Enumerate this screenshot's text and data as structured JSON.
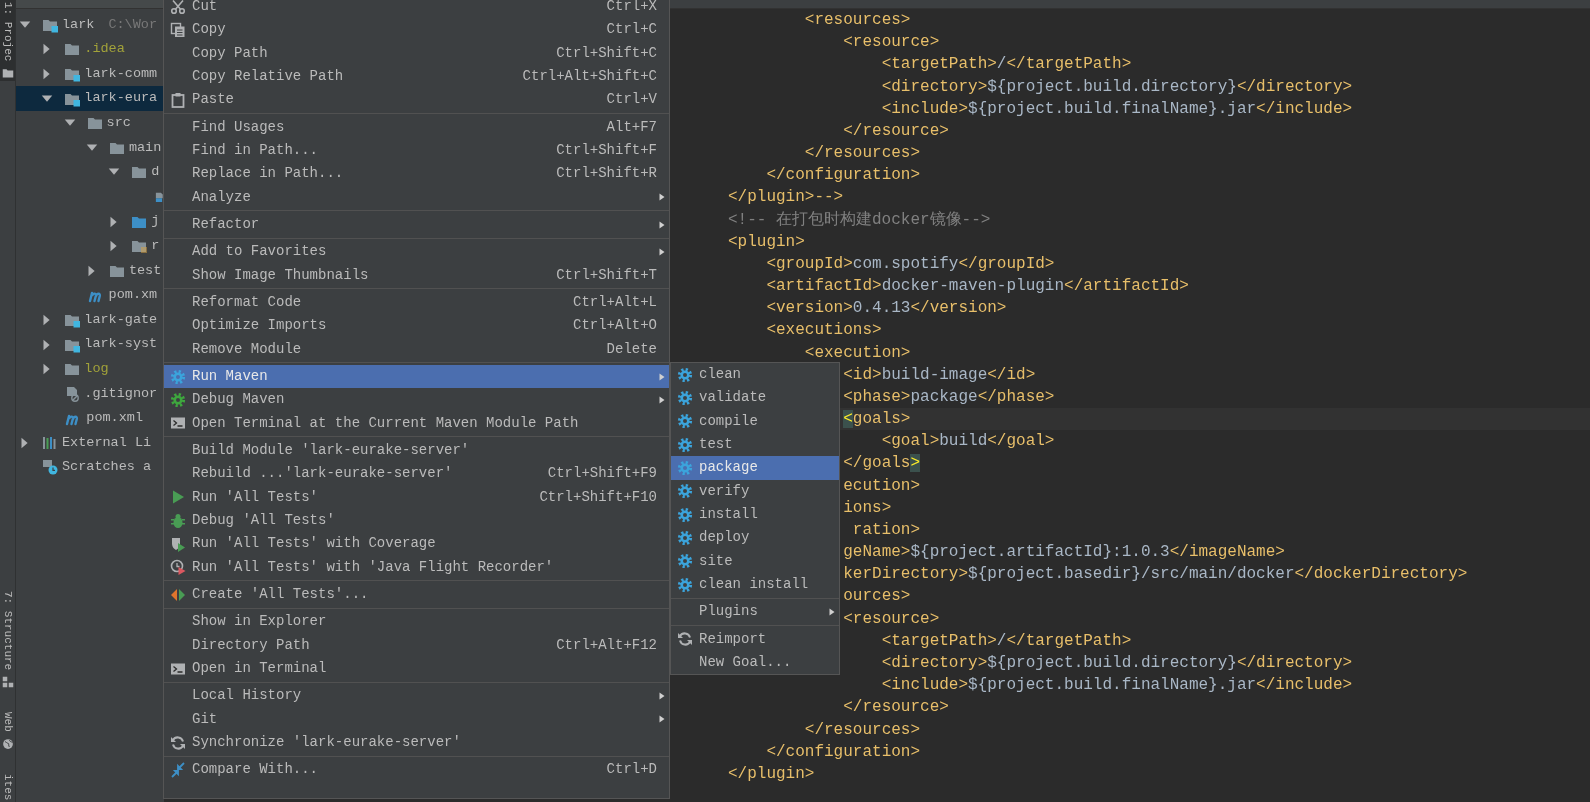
{
  "tool_strip": {
    "top": [
      {
        "label": "1: Projec",
        "kind": "project",
        "selected": true
      }
    ],
    "bottom": [
      {
        "label": "7: Structure",
        "kind": "structure",
        "selected": false
      },
      {
        "label": "Web",
        "kind": "web",
        "selected": false
      },
      {
        "label": "ites",
        "kind": "plain",
        "selected": false
      }
    ]
  },
  "project_tree": {
    "items": [
      {
        "label": "lark",
        "path": "C:\\Wor",
        "kind": "module",
        "expanded": true,
        "ignored": false,
        "selected": false,
        "children": [
          {
            "label": ".idea",
            "kind": "folder",
            "expanded": false,
            "ignored": true,
            "selected": false
          },
          {
            "label": "lark-comm",
            "kind": "module",
            "expanded": false,
            "ignored": false,
            "selected": false
          },
          {
            "label": "lark-eura",
            "kind": "module",
            "expanded": true,
            "ignored": false,
            "selected": true,
            "children": [
              {
                "label": "src",
                "kind": "folder",
                "expanded": true,
                "ignored": false,
                "selected": false,
                "children": [
                  {
                    "label": "main",
                    "kind": "folder",
                    "expanded": true,
                    "ignored": false,
                    "selected": false,
                    "children": [
                      {
                        "label": "d",
                        "kind": "folder",
                        "expanded": true,
                        "ignored": false,
                        "selected": false,
                        "children": [
                          {
                            "kind": "docker-file",
                            "ignored": false,
                            "selected": false
                          }
                        ]
                      },
                      {
                        "label": "j",
                        "kind": "source-folder",
                        "expanded": false,
                        "ignored": false,
                        "selected": false
                      },
                      {
                        "label": "r",
                        "kind": "resource-folder",
                        "expanded": false,
                        "ignored": false,
                        "selected": false
                      }
                    ]
                  },
                  {
                    "label": "test",
                    "kind": "folder",
                    "expanded": false,
                    "ignored": false,
                    "selected": false
                  }
                ]
              },
              {
                "label": "pom.xm",
                "kind": "maven-file",
                "ignored": false,
                "selected": false
              }
            ]
          },
          {
            "label": "lark-gate",
            "kind": "module",
            "expanded": false,
            "ignored": false,
            "selected": false
          },
          {
            "label": "lark-syst",
            "kind": "module",
            "expanded": false,
            "ignored": false,
            "selected": false
          },
          {
            "label": "log",
            "kind": "folder",
            "expanded": false,
            "ignored": true,
            "selected": false
          },
          {
            "label": ".gitignor",
            "kind": "ignore-file",
            "ignored": false,
            "selected": false
          },
          {
            "label": "pom.xml",
            "kind": "maven-file",
            "ignored": false,
            "selected": false
          }
        ]
      },
      {
        "label": "External Li",
        "kind": "libraries",
        "expanded": false,
        "ignored": false,
        "selected": false
      },
      {
        "label": "Scratches a",
        "kind": "scratches",
        "ignored": false,
        "selected": false
      }
    ]
  },
  "editor": {
    "lines": [
      {
        "current": false,
        "spans": [
          {
            "kind": "tag",
            "text": "        <resources>"
          }
        ]
      },
      {
        "current": false,
        "spans": [
          {
            "kind": "tag",
            "text": "            <resource>"
          }
        ]
      },
      {
        "current": false,
        "spans": [
          {
            "kind": "tag",
            "text": "                <targetPath>"
          },
          {
            "kind": "text",
            "text": "/"
          },
          {
            "kind": "tag",
            "text": "</targetPath>"
          }
        ]
      },
      {
        "current": false,
        "spans": [
          {
            "kind": "tag",
            "text": "                <directory>"
          },
          {
            "kind": "text",
            "text": "${project.build.directory}"
          },
          {
            "kind": "tag",
            "text": "</directory>"
          }
        ]
      },
      {
        "current": false,
        "spans": [
          {
            "kind": "tag",
            "text": "                <include>"
          },
          {
            "kind": "text",
            "text": "${project.build.finalName}.jar"
          },
          {
            "kind": "tag",
            "text": "</include>"
          }
        ]
      },
      {
        "current": false,
        "spans": [
          {
            "kind": "tag",
            "text": "            </resource>"
          }
        ]
      },
      {
        "current": false,
        "spans": [
          {
            "kind": "tag",
            "text": "        </resources>"
          }
        ]
      },
      {
        "current": false,
        "spans": [
          {
            "kind": "tag",
            "text": "    </configuration>"
          }
        ]
      },
      {
        "current": false,
        "spans": [
          {
            "kind": "tag",
            "text": "</plugin>-->"
          }
        ]
      },
      {
        "current": false,
        "spans": [
          {
            "kind": "comment",
            "text": "<!-- 在打包时构建docker镜像-->"
          }
        ]
      },
      {
        "current": false,
        "spans": [
          {
            "kind": "tag",
            "text": "<plugin>"
          }
        ]
      },
      {
        "current": false,
        "spans": [
          {
            "kind": "tag",
            "text": "    <groupId>"
          },
          {
            "kind": "text",
            "text": "com.spotify"
          },
          {
            "kind": "tag",
            "text": "</groupId>"
          }
        ]
      },
      {
        "current": false,
        "spans": [
          {
            "kind": "tag",
            "text": "    <artifactId>"
          },
          {
            "kind": "text",
            "text": "docker-maven-plugin"
          },
          {
            "kind": "tag",
            "text": "</artifactId>"
          }
        ]
      },
      {
        "current": false,
        "spans": [
          {
            "kind": "tag",
            "text": "    <version>"
          },
          {
            "kind": "text",
            "text": "0.4.13"
          },
          {
            "kind": "tag",
            "text": "</version>"
          }
        ]
      },
      {
        "current": false,
        "spans": [
          {
            "kind": "tag",
            "text": "    <executions>"
          }
        ]
      },
      {
        "current": false,
        "spans": [
          {
            "kind": "tag",
            "text": "        <execution>"
          }
        ]
      },
      {
        "current": false,
        "spans": [
          {
            "kind": "tag",
            "text": "            <id>"
          },
          {
            "kind": "text",
            "text": "build-image"
          },
          {
            "kind": "tag",
            "text": "</id>"
          }
        ]
      },
      {
        "current": false,
        "spans": [
          {
            "kind": "tag",
            "text": "            <phase>"
          },
          {
            "kind": "text",
            "text": "package"
          },
          {
            "kind": "tag",
            "text": "</phase>"
          }
        ]
      },
      {
        "current": true,
        "spans": [
          {
            "kind": "match",
            "text": "            <"
          },
          {
            "kind": "tag",
            "text": "goals>"
          }
        ]
      },
      {
        "current": false,
        "spans": [
          {
            "kind": "tag",
            "text": "                <goal>"
          },
          {
            "kind": "text",
            "text": "build"
          },
          {
            "kind": "tag",
            "text": "</goal>"
          }
        ]
      },
      {
        "current": false,
        "spans": [
          {
            "kind": "tag",
            "text": "            </goals"
          },
          {
            "kind": "match",
            "text": ">"
          }
        ]
      },
      {
        "current": false,
        "spans": [
          {
            "kind": "tag",
            "text": "            ecution>"
          }
        ]
      },
      {
        "current": false,
        "spans": [
          {
            "kind": "tag",
            "text": "            ions>"
          }
        ]
      },
      {
        "current": false,
        "spans": [
          {
            "kind": "tag",
            "text": "             ration>"
          }
        ]
      },
      {
        "current": false,
        "spans": [
          {
            "kind": "tag",
            "text": "            geName>"
          },
          {
            "kind": "text",
            "text": "${project.artifactId}:1.0.3"
          },
          {
            "kind": "tag",
            "text": "</imageName>"
          }
        ]
      },
      {
        "current": false,
        "spans": [
          {
            "kind": "tag",
            "text": "            kerDirectory>"
          },
          {
            "kind": "text",
            "text": "${project.basedir}/src/main/docker"
          },
          {
            "kind": "tag",
            "text": "</dockerDirectory>"
          }
        ]
      },
      {
        "current": false,
        "spans": [
          {
            "kind": "tag",
            "text": "            ources>"
          }
        ]
      },
      {
        "current": false,
        "spans": [
          {
            "kind": "tag",
            "text": "            <resource>"
          }
        ]
      },
      {
        "current": false,
        "spans": [
          {
            "kind": "tag",
            "text": "                <targetPath>"
          },
          {
            "kind": "text",
            "text": "/"
          },
          {
            "kind": "tag",
            "text": "</targetPath>"
          }
        ]
      },
      {
        "current": false,
        "spans": [
          {
            "kind": "tag",
            "text": "                <directory>"
          },
          {
            "kind": "text",
            "text": "${project.build.directory}"
          },
          {
            "kind": "tag",
            "text": "</directory>"
          }
        ]
      },
      {
        "current": false,
        "spans": [
          {
            "kind": "tag",
            "text": "                <include>"
          },
          {
            "kind": "text",
            "text": "${project.build.finalName}.jar"
          },
          {
            "kind": "tag",
            "text": "</include>"
          }
        ]
      },
      {
        "current": false,
        "spans": [
          {
            "kind": "tag",
            "text": "            </resource>"
          }
        ]
      },
      {
        "current": false,
        "spans": [
          {
            "kind": "tag",
            "text": "        </resources>"
          }
        ]
      },
      {
        "current": false,
        "spans": [
          {
            "kind": "tag",
            "text": "    </configuration>"
          }
        ]
      },
      {
        "current": false,
        "spans": [
          {
            "kind": "tag",
            "text": "</plugin>"
          }
        ]
      }
    ]
  },
  "context_menu": {
    "groups": [
      {
        "items": [
          {
            "label": "Cut",
            "shortcut": "Ctrl+X",
            "kind": "scissors",
            "submenu": false,
            "selected": false
          },
          {
            "label": "Copy",
            "shortcut": "Ctrl+C",
            "kind": "copy",
            "submenu": false,
            "selected": false
          },
          {
            "label": "Copy Path",
            "shortcut": "Ctrl+Shift+C",
            "kind": "plain",
            "submenu": false,
            "selected": false
          },
          {
            "label": "Copy Relative Path",
            "shortcut": "Ctrl+Alt+Shift+C",
            "kind": "plain",
            "submenu": false,
            "selected": false
          },
          {
            "label": "Paste",
            "shortcut": "Ctrl+V",
            "kind": "paste",
            "submenu": false,
            "selected": false
          }
        ]
      },
      {
        "items": [
          {
            "label": "Find Usages",
            "shortcut": "Alt+F7",
            "kind": "plain",
            "submenu": false,
            "selected": false
          },
          {
            "label": "Find in Path...",
            "shortcut": "Ctrl+Shift+F",
            "kind": "plain",
            "submenu": false,
            "selected": false
          },
          {
            "label": "Replace in Path...",
            "shortcut": "Ctrl+Shift+R",
            "kind": "plain",
            "submenu": false,
            "selected": false
          },
          {
            "label": "Analyze",
            "kind": "plain",
            "submenu": true,
            "selected": false
          }
        ]
      },
      {
        "items": [
          {
            "label": "Refactor",
            "kind": "plain",
            "submenu": true,
            "selected": false
          }
        ]
      },
      {
        "items": [
          {
            "label": "Add to Favorites",
            "kind": "plain",
            "submenu": true,
            "selected": false
          },
          {
            "label": "Show Image Thumbnails",
            "shortcut": "Ctrl+Shift+T",
            "kind": "plain",
            "submenu": false,
            "selected": false
          }
        ]
      },
      {
        "items": [
          {
            "label": "Reformat Code",
            "shortcut": "Ctrl+Alt+L",
            "kind": "plain",
            "submenu": false,
            "selected": false
          },
          {
            "label": "Optimize Imports",
            "shortcut": "Ctrl+Alt+O",
            "kind": "plain",
            "submenu": false,
            "selected": false
          },
          {
            "label": "Remove Module",
            "shortcut": "Delete",
            "kind": "plain",
            "submenu": false,
            "selected": false
          }
        ]
      },
      {
        "items": [
          {
            "label": "Run Maven",
            "kind": "maven",
            "submenu": true,
            "selected": true
          },
          {
            "label": "Debug Maven",
            "kind": "maven-debug",
            "submenu": true,
            "selected": false
          },
          {
            "label": "Open Terminal at the Current Maven Module Path",
            "kind": "terminal",
            "submenu": false,
            "selected": false
          }
        ]
      },
      {
        "items": [
          {
            "label": "Build Module 'lark-eurake-server'",
            "kind": "plain",
            "submenu": false,
            "selected": false
          },
          {
            "label": "Rebuild ...'lark-eurake-server'",
            "shortcut": "Ctrl+Shift+F9",
            "kind": "plain",
            "submenu": false,
            "selected": false
          },
          {
            "label": "Run 'All Tests'",
            "shortcut": "Ctrl+Shift+F10",
            "kind": "run",
            "submenu": false,
            "selected": false
          },
          {
            "label": "Debug 'All Tests'",
            "kind": "debug",
            "submenu": false,
            "selected": false
          },
          {
            "label": "Run 'All Tests' with Coverage",
            "kind": "coverage",
            "submenu": false,
            "selected": false
          },
          {
            "label": "Run 'All Tests' with 'Java Flight Recorder'",
            "kind": "recorder",
            "submenu": false,
            "selected": false
          }
        ]
      },
      {
        "items": [
          {
            "label": "Create 'All Tests'...",
            "kind": "create",
            "submenu": false,
            "selected": false
          }
        ]
      },
      {
        "items": [
          {
            "label": "Show in Explorer",
            "kind": "plain",
            "submenu": false,
            "selected": false
          },
          {
            "label": "Directory Path",
            "shortcut": "Ctrl+Alt+F12",
            "kind": "plain",
            "submenu": false,
            "selected": false
          },
          {
            "label": "Open in Terminal",
            "kind": "terminal",
            "submenu": false,
            "selected": false
          }
        ]
      },
      {
        "items": [
          {
            "label": "Local History",
            "kind": "plain",
            "submenu": true,
            "selected": false
          },
          {
            "label": "Git",
            "kind": "plain",
            "submenu": true,
            "selected": false
          },
          {
            "label": "Synchronize 'lark-eurake-server'",
            "kind": "sync",
            "submenu": false,
            "selected": false
          }
        ]
      },
      {
        "items": [
          {
            "label": "Compare With...",
            "shortcut": "Ctrl+D",
            "kind": "compare",
            "submenu": false,
            "selected": false
          }
        ]
      }
    ]
  },
  "submenu": {
    "groups": [
      {
        "items": [
          {
            "label": "clean",
            "kind": "maven",
            "submenu": false,
            "selected": false
          },
          {
            "label": "validate",
            "kind": "maven",
            "submenu": false,
            "selected": false
          },
          {
            "label": "compile",
            "kind": "maven",
            "submenu": false,
            "selected": false
          },
          {
            "label": "test",
            "kind": "maven",
            "submenu": false,
            "selected": false
          },
          {
            "label": "package",
            "kind": "maven",
            "submenu": false,
            "selected": true
          },
          {
            "label": "verify",
            "kind": "maven",
            "submenu": false,
            "selected": false
          },
          {
            "label": "install",
            "kind": "maven",
            "submenu": false,
            "selected": false
          },
          {
            "label": "deploy",
            "kind": "maven",
            "submenu": false,
            "selected": false
          },
          {
            "label": "site",
            "kind": "maven",
            "submenu": false,
            "selected": false
          },
          {
            "label": "clean install",
            "kind": "maven",
            "submenu": false,
            "selected": false
          }
        ]
      },
      {
        "items": [
          {
            "label": "Plugins",
            "kind": "plain",
            "submenu": true,
            "selected": false
          }
        ]
      },
      {
        "items": [
          {
            "label": "Reimport",
            "kind": "sync",
            "submenu": false,
            "selected": false
          },
          {
            "label": "New Goal...",
            "kind": "plain",
            "submenu": false,
            "selected": false
          }
        ]
      }
    ]
  }
}
